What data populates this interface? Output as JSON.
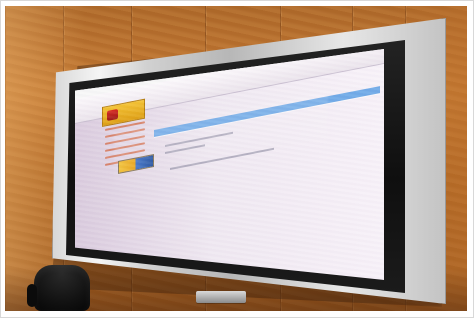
{
  "colors": {
    "wall": "#b06a2a",
    "bezel_silver": "#d7d7d7",
    "bezel_black": "#111111",
    "screen_background": "#efe8f1",
    "window_blue": "#2d67d1",
    "taskbar_blue": "#2a60c6",
    "logo_gold": "#de9e10",
    "logo_red": "#d7261c",
    "chair_black": "#111111"
  },
  "icons": {
    "minimize": "minimize-icon",
    "maximize": "maximize-icon",
    "close": "close-icon"
  }
}
